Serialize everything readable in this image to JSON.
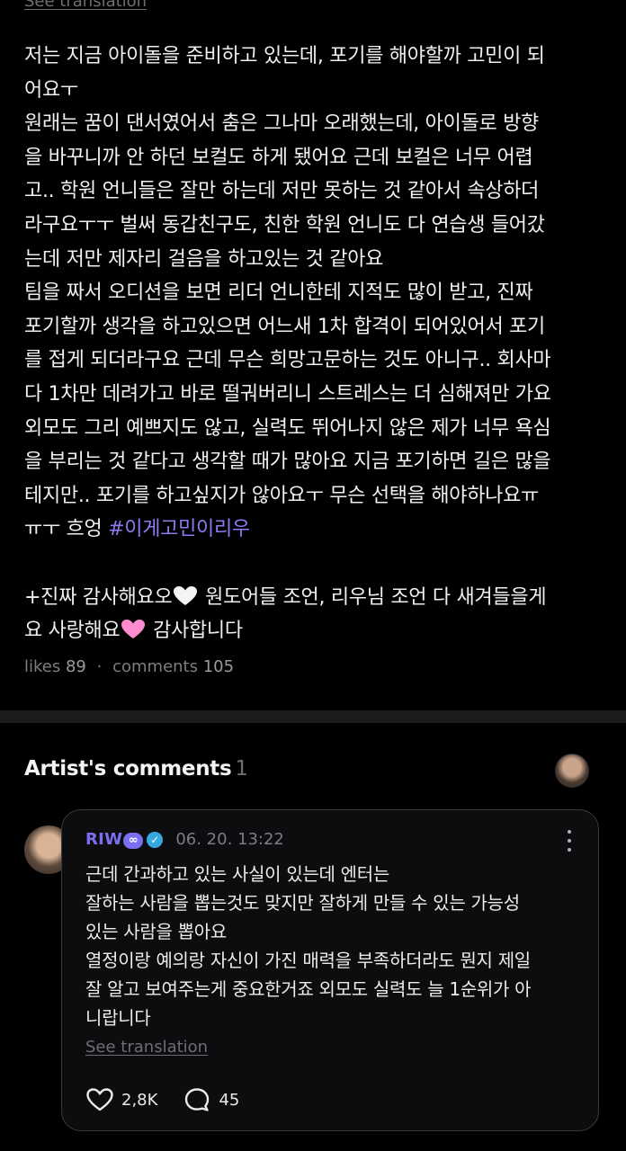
{
  "top": {
    "see_translation": "See translation"
  },
  "post": {
    "lines": [
      "저는 지금 아이돌을 준비하고 있는데, 포기를 해야할까 고민이 되",
      "어요ㅜ",
      "원래는 꿈이 댄서였어서 춤은 그나마 오래했는데, 아이돌로 방향",
      "을 바꾸니까 안 하던 보컬도 하게 됐어요 근데 보컬은 너무 어렵",
      "고.. 학원 언니들은 잘만 하는데 저만 못하는 것 같아서 속상하더",
      "라구요ㅜㅜ 벌써 동갑친구도, 친한 학원 언니도 다 연습생 들어갔",
      "는데 저만 제자리 걸음을 하고있는 것 같아요",
      "팀을 짜서 오디션을 보면 리더 언니한테 지적도 많이 받고, 진짜",
      "포기할까 생각을 하고있으면 어느새 1차 합격이 되어있어서 포기",
      "를 접게 되더라구요 근데 무슨 희망고문하는 것도 아니구.. 회사마",
      "다 1차만 데려가고 바로 떨궈버리니 스트레스는 더 심해져만 가요",
      "외모도 그리 예쁘지도 않고, 실력도 뛰어나지 않은 제가 너무 욕심",
      "을 부리는 것 같다고 생각할 때가 많아요 지금 포기하면 길은 많을",
      "테지만.. 포기를 하고싶지가 않아요ㅜ 무슨 선택을 해야하나요ㅠ"
    ],
    "last_line_prefix": "ㅠㅜ 흐엉 ",
    "hashtag": "#이게고민이리우",
    "thanks_part1": "+진짜 감사해요오",
    "thanks_part2": " 원도어들 조언, 리우님 조언 다 새겨들을게",
    "thanks_part3": "요 사랑해요",
    "thanks_part4": " 감사합니다",
    "likes_label": "likes",
    "likes_count": "89",
    "comments_label": "comments",
    "comments_count": "105"
  },
  "section": {
    "title": "Artist's comments",
    "count": "1"
  },
  "comment": {
    "name": "RIW",
    "badge": "∞",
    "time": "06. 20. 13:22",
    "lines": [
      "근데 간과하고 있는 사실이 있는데 엔터는",
      "잘하는 사람을 뽑는것도 맞지만 잘하게 만들 수 있는 가능성",
      "있는 사람을 뽑아요",
      "열정이랑 예의랑 자신이 가진 매력을 부족하더라도 뭔지 제일",
      "잘 알고 보여주는게 중요한거죠 외모도 실력도 늘 1순위가 아",
      "니랍니다"
    ],
    "see_translation": "See translation",
    "likes": "2,8K",
    "replies": "45"
  },
  "colors": {
    "accent": "#7a6ff0",
    "hashtag": "#8b7cf0",
    "verified": "#35a8e0",
    "heart_pink": "#ff8ccf"
  }
}
